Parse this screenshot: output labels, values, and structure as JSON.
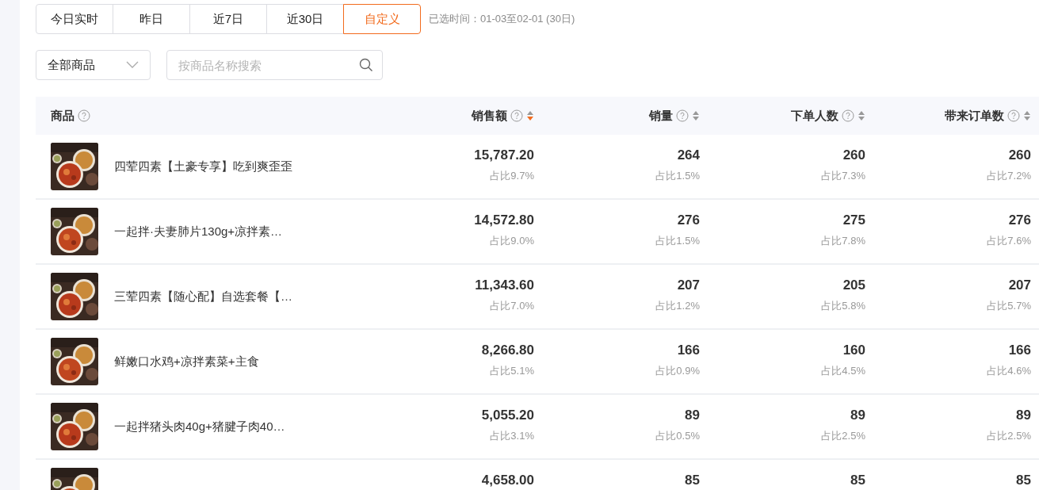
{
  "date_tabs": [
    {
      "label": "今日实时",
      "selected": false
    },
    {
      "label": "昨日",
      "selected": false
    },
    {
      "label": "近7日",
      "selected": false
    },
    {
      "label": "近30日",
      "selected": false
    },
    {
      "label": "自定义",
      "selected": true
    }
  ],
  "selected_range": "已选时间：01-03至02-01 (30日)",
  "category_select": {
    "value": "全部商品"
  },
  "search": {
    "placeholder": "按商品名称搜索"
  },
  "table": {
    "columns": [
      {
        "label": "商品",
        "kind": "product"
      },
      {
        "label": "销售额",
        "kind": "metric",
        "sorted_descending": true
      },
      {
        "label": "销量",
        "kind": "metric",
        "sorted_descending": false
      },
      {
        "label": "下单人数",
        "kind": "metric",
        "sorted_descending": false
      },
      {
        "label": "带来订单数",
        "kind": "metric",
        "sorted_descending": false
      }
    ],
    "rows": [
      {
        "name": "四荤四素【土豪专享】吃到爽歪歪",
        "image": {
          "kind": "picture"
        },
        "metrics": [
          {
            "value": "15,787.20",
            "share": "占比9.7%"
          },
          {
            "value": "264",
            "share": "占比1.5%"
          },
          {
            "value": "260",
            "share": "占比7.3%"
          },
          {
            "value": "260",
            "share": "占比7.2%"
          }
        ]
      },
      {
        "name": "一起拌·夫妻肺片130g+凉拌素…",
        "image": {
          "kind": "picture"
        },
        "metrics": [
          {
            "value": "14,572.80",
            "share": "占比9.0%"
          },
          {
            "value": "276",
            "share": "占比1.5%"
          },
          {
            "value": "275",
            "share": "占比7.8%"
          },
          {
            "value": "276",
            "share": "占比7.6%"
          }
        ]
      },
      {
        "name": "三荤四素【随心配】自选套餐【…",
        "image": {
          "kind": "picture"
        },
        "metrics": [
          {
            "value": "11,343.60",
            "share": "占比7.0%"
          },
          {
            "value": "207",
            "share": "占比1.2%"
          },
          {
            "value": "205",
            "share": "占比5.8%"
          },
          {
            "value": "207",
            "share": "占比5.7%"
          }
        ]
      },
      {
        "name": "鲜嫩口水鸡+凉拌素菜+主食",
        "image": {
          "kind": "picture"
        },
        "metrics": [
          {
            "value": "8,266.80",
            "share": "占比5.1%"
          },
          {
            "value": "166",
            "share": "占比0.9%"
          },
          {
            "value": "160",
            "share": "占比4.5%"
          },
          {
            "value": "166",
            "share": "占比4.6%"
          }
        ]
      },
      {
        "name": "一起拌猪头肉40g+猪腱子肉40…",
        "image": {
          "kind": "picture"
        },
        "metrics": [
          {
            "value": "5,055.20",
            "share": "占比3.1%"
          },
          {
            "value": "89",
            "share": "占比0.5%"
          },
          {
            "value": "89",
            "share": "占比2.5%"
          },
          {
            "value": "89",
            "share": "占比2.5%"
          }
        ]
      },
      {
        "image": {
          "kind": "picture"
        },
        "metrics": [
          {
            "value": "4,658.00"
          },
          {
            "value": "85"
          },
          {
            "value": "85"
          },
          {
            "value": "85"
          }
        ]
      }
    ]
  }
}
